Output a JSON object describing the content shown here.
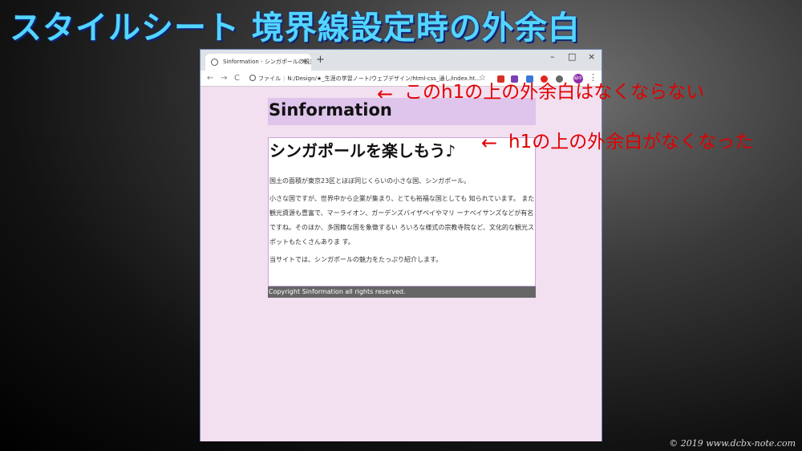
{
  "slide": {
    "title": "スタイルシート 境界線設定時の外余白"
  },
  "browser": {
    "tab_title": "Sinformation - シンガポールの観光",
    "tab_close": "×",
    "new_tab": "+",
    "window_controls": {
      "minimize": "–",
      "maximize": "□",
      "close": "×"
    },
    "nav": {
      "back": "←",
      "forward": "→",
      "reload": "C"
    },
    "address_label": "ファイル",
    "address_url": "N:/Design/★_生涯の学習ノート/ウェブデザイン/html-css_通し/index.ht...",
    "star": "☆",
    "avatar_text": "緑中",
    "menu": "⋮",
    "extensions": [
      {
        "name": "gmail-icon",
        "color": "#d93025"
      },
      {
        "name": "onenote-icon",
        "color": "#7b3fb6"
      },
      {
        "name": "extension-icon",
        "color": "#3b78d8"
      },
      {
        "name": "record-icon",
        "color": "#e0281e"
      },
      {
        "name": "pin-icon",
        "color": "#666666"
      }
    ]
  },
  "page": {
    "site_title": "Sinformation",
    "heading": "シンガポールを楽しもう♪",
    "paragraphs": [
      "国土の面積が東京23区とほぼ同じくらいの小さな国、シンガポール。",
      "小さな国ですが、世界中から企業が集まり、とても裕福な国としても 知られています。 また観光資源も豊富で、マーライオン、ガーデンズバイザベイやマリ ーナベイサンズなどが有名ですね。そのほか、多国籍な国を象徴するい ろいろな様式の宗教寺院など、文化的な観光スポットもたくさんありま す。",
      "当サイトでは、シンガポールの魅力をたっぷり紹介します。"
    ],
    "footer": "Copyright Sinformation all rights reserved."
  },
  "annotations": {
    "arrow": "←",
    "header_note": "このh1の上の外余白はなくならない",
    "main_note": "h1の上の外余白がなくなった"
  },
  "watermark": "© 2019 www.dcbx-note.com",
  "colors": {
    "title": "#52d6ff",
    "annotation": "#e10000",
    "page_bg": "#f2dff0",
    "header_bg": "#dfc4ec",
    "footer_bg": "#666666"
  }
}
